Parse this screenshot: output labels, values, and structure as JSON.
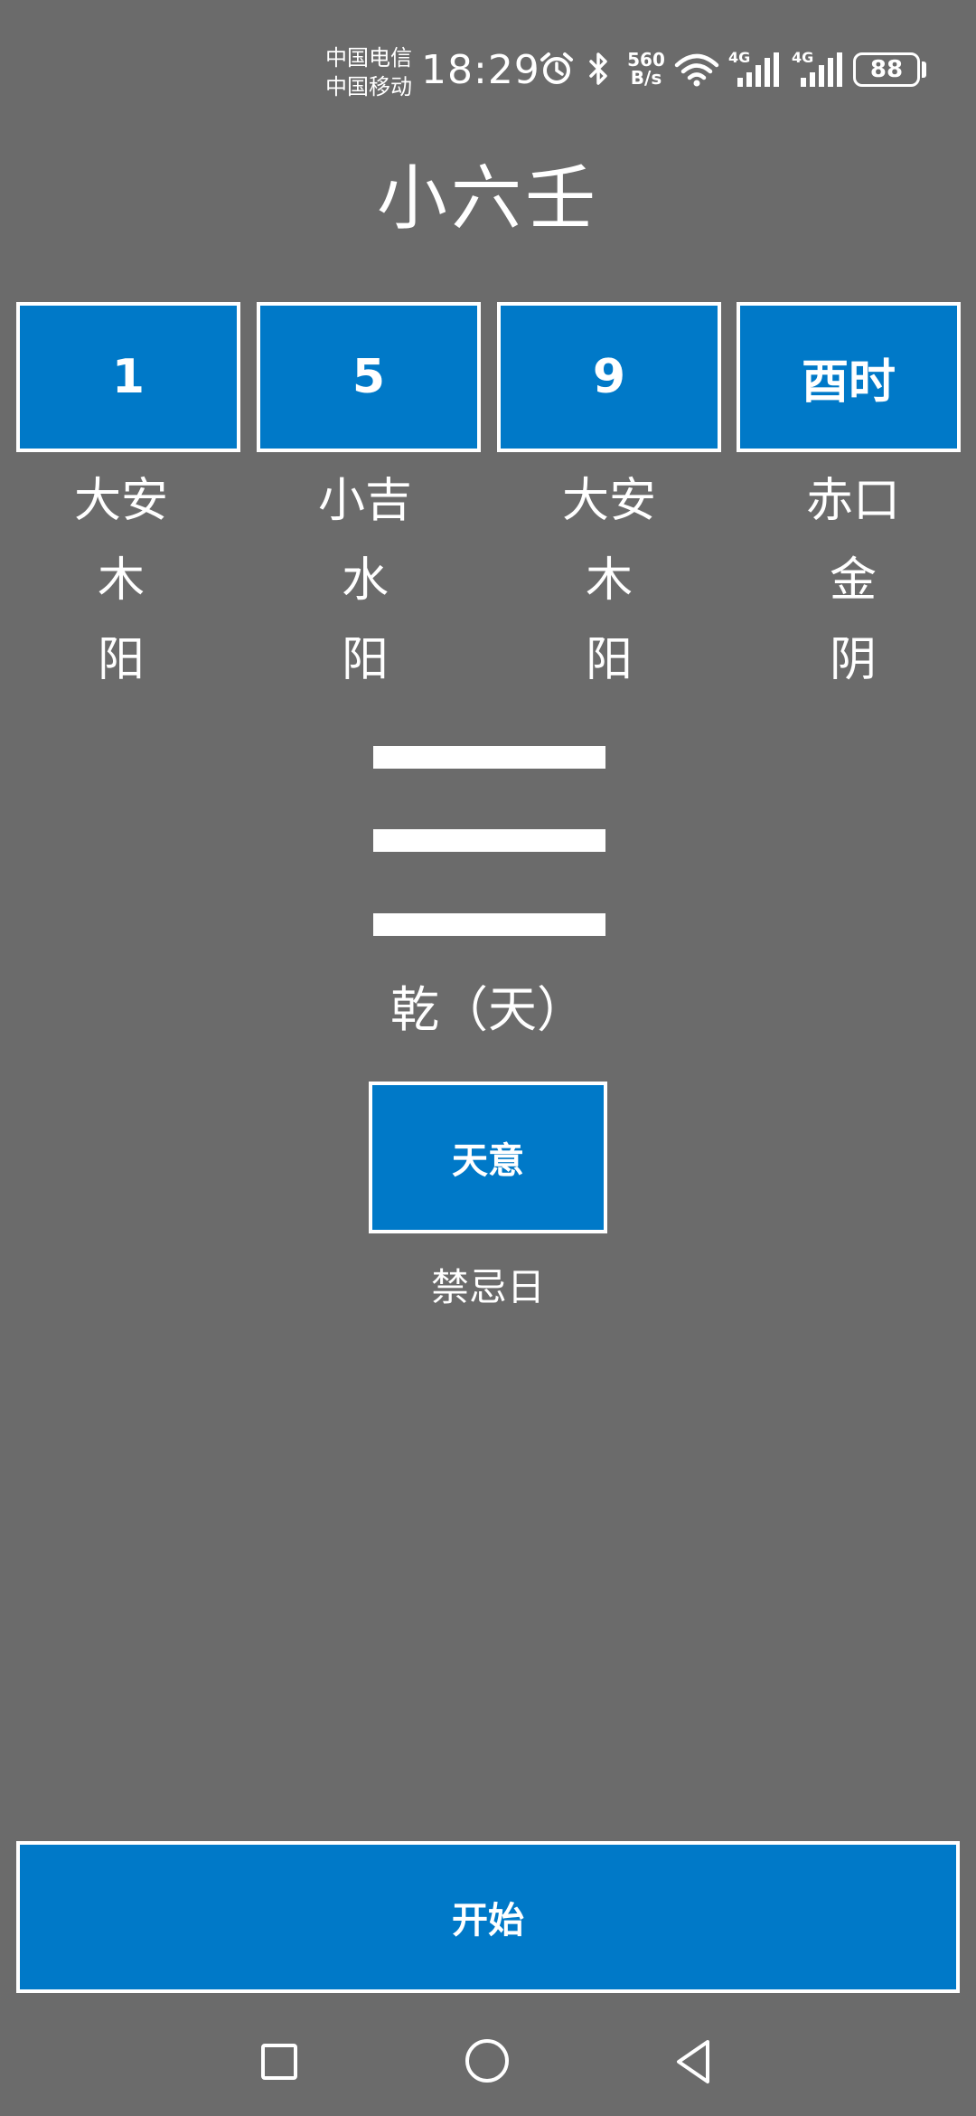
{
  "status_bar": {
    "carrier_1": "中国电信",
    "carrier_2": "中国移动",
    "time": "18:29",
    "speed_value": "560",
    "speed_unit": "B/s",
    "network_1": "4G",
    "network_2": "4G",
    "battery": "88",
    "icons": [
      "alarm-icon",
      "bluetooth-icon",
      "wifi-icon",
      "signal-icon",
      "signal-icon",
      "battery-icon"
    ]
  },
  "title": "小六壬",
  "boxes": [
    "1",
    "5",
    "9",
    "酉时"
  ],
  "columns": [
    {
      "name": "大安",
      "element": "木",
      "polarity": "阳"
    },
    {
      "name": "小吉",
      "element": "水",
      "polarity": "阳"
    },
    {
      "name": "大安",
      "element": "木",
      "polarity": "阳"
    },
    {
      "name": "赤口",
      "element": "金",
      "polarity": "阴"
    }
  ],
  "trigram": {
    "lines": [
      "solid",
      "solid",
      "solid"
    ],
    "name": "乾（天）"
  },
  "middle_button": "天意",
  "note": "禁忌日",
  "start_button": "开始",
  "colors": {
    "background": "#6b6b6b",
    "accent": "#0079c8",
    "text": "#ffffff"
  }
}
